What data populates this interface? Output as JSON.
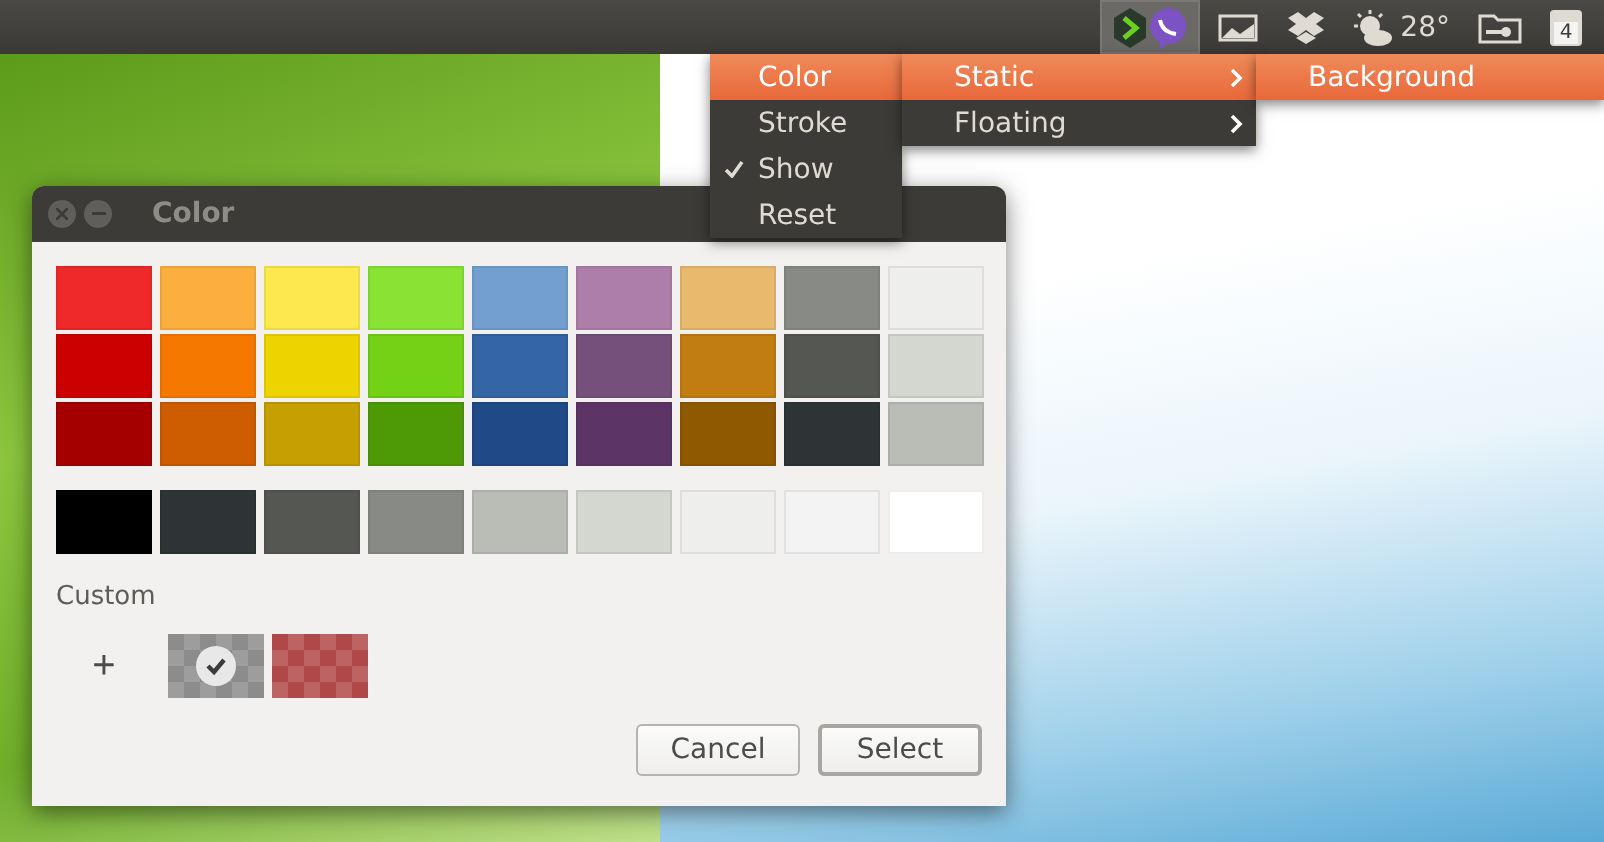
{
  "top_panel": {
    "indicators": [
      {
        "kind": "apps",
        "selected": true
      },
      {
        "kind": "screen",
        "selected": false
      },
      {
        "kind": "box",
        "selected": false
      },
      {
        "kind": "weather",
        "selected": false,
        "text": "28°"
      },
      {
        "kind": "folder-key",
        "selected": false
      },
      {
        "kind": "calendar",
        "selected": false,
        "text": "4"
      }
    ]
  },
  "menus": [
    {
      "items": [
        {
          "label": "Color",
          "selected": true,
          "checked": false
        },
        {
          "label": "Stroke",
          "selected": false,
          "checked": false
        },
        {
          "label": "Show",
          "selected": false,
          "checked": true
        },
        {
          "label": "Reset",
          "selected": false,
          "checked": false
        }
      ]
    },
    {
      "items": [
        {
          "label": "Static",
          "selected": true,
          "submenu": true
        },
        {
          "label": "Floating",
          "selected": false,
          "submenu": true
        }
      ]
    },
    {
      "items": [
        {
          "label": "Background",
          "selected": true,
          "submenu": false
        }
      ]
    }
  ],
  "dialog": {
    "title": "Color",
    "palette": [
      [
        {
          "color": "#ef2929"
        },
        {
          "color": "#fcaf3e"
        },
        {
          "color": "#fce94f"
        },
        {
          "color": "#8ae234"
        },
        {
          "color": "#729fcf"
        },
        {
          "color": "#ad7fa8"
        },
        {
          "color": "#e9b96e"
        },
        {
          "color": "#888a85"
        },
        {
          "color": "#eeeeec"
        }
      ],
      [
        {
          "color": "#cc0000"
        },
        {
          "color": "#f57900"
        },
        {
          "color": "#edd400"
        },
        {
          "color": "#73d216"
        },
        {
          "color": "#3465a4"
        },
        {
          "color": "#75507b"
        },
        {
          "color": "#c17d11"
        },
        {
          "color": "#555753"
        },
        {
          "color": "#d3d7cf"
        }
      ],
      [
        {
          "color": "#a40000"
        },
        {
          "color": "#ce5c00"
        },
        {
          "color": "#c4a000"
        },
        {
          "color": "#4e9a06"
        },
        {
          "color": "#204a87"
        },
        {
          "color": "#5c3566"
        },
        {
          "color": "#8f5902"
        },
        {
          "color": "#2e3436"
        },
        {
          "color": "#babdb6"
        }
      ]
    ],
    "grays": [
      {
        "color": "#000000"
      },
      {
        "color": "#2e3436"
      },
      {
        "color": "#555753"
      },
      {
        "color": "#888a85"
      },
      {
        "color": "#babdb6"
      },
      {
        "color": "#d3d7cf"
      },
      {
        "color": "#eeeeec"
      },
      {
        "color": "#f3f3f3"
      },
      {
        "color": "#ffffff"
      }
    ],
    "custom_label": "Custom",
    "add_button": "+",
    "custom": [
      {
        "color": "#8c8c8c",
        "selected": true
      },
      {
        "color": "#b04848",
        "selected": false
      }
    ],
    "buttons": [
      {
        "label": "Cancel",
        "selected": false
      },
      {
        "label": "Select",
        "selected": true
      }
    ]
  }
}
